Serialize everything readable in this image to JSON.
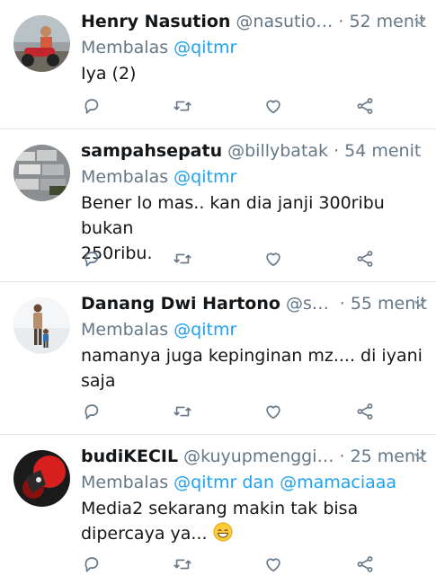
{
  "tweets": [
    {
      "name": "Henry Nasution",
      "handle": "@nasutio…",
      "dot": "·",
      "time": "52 menit",
      "reply_prefix": "Membalas",
      "reply_mentions": "@qitmr",
      "text_lines": [
        "Iya (2)"
      ],
      "avatar": "avatar-person-on-motorbike"
    },
    {
      "name": "sampahsepatu",
      "handle": "@billybatak",
      "dot": "·",
      "time": "54 menit",
      "reply_prefix": "Membalas",
      "reply_mentions": "@qitmr",
      "text_lines": [
        "Bener lo mas.. kan dia janji 300ribu bukan",
        "250ribu."
      ],
      "avatar": "avatar-shoe-pile"
    },
    {
      "name": "Danang Dwi Hartono",
      "handle": "@sq…",
      "dot": "·",
      "time": "55 menit",
      "reply_prefix": "Membalas",
      "reply_mentions": "@qitmr",
      "text_lines": [
        "namanya juga kepinginan mz.... di iyani",
        "saja"
      ],
      "avatar": "avatar-man-and-child"
    },
    {
      "name": "budiKECIL",
      "handle": "@kuyupmenggi…",
      "dot": "·",
      "time": "25 menit",
      "reply_prefix": "Membalas",
      "reply_mentions": "@qitmr dan @mamaciaaa",
      "text_lines": [
        "Media2 sekarang makin tak bisa",
        "dipercaya ya..."
      ],
      "emoji": "grinning-smile-emoji",
      "avatar": "avatar-red-dark-graphic"
    }
  ],
  "icons": {
    "reply": "reply-icon",
    "retweet": "retweet-icon",
    "like": "heart-icon",
    "share": "share-icon",
    "menu": "chevron-down-icon"
  },
  "colors": {
    "link": "#1da1f2",
    "secondary_text": "#657786",
    "primary_text": "#14171a",
    "divider": "#e1e8ed"
  }
}
